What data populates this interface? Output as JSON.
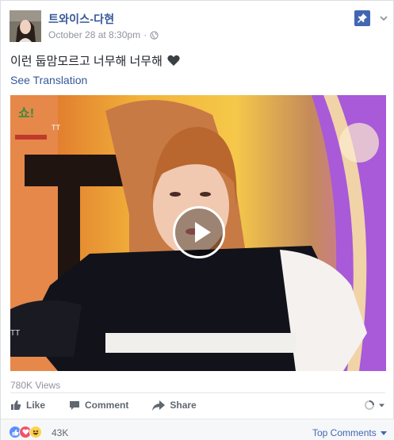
{
  "post": {
    "page_name": "트와이스-다현",
    "timestamp": "October 28 at 8:30pm",
    "separator": "·",
    "text": "이런 둡맘모르고 너무해 너무해",
    "see_translation": "See Translation"
  },
  "video": {
    "overlay_text": "TT",
    "views": "780K Views"
  },
  "actions": {
    "like": "Like",
    "comment": "Comment",
    "share": "Share"
  },
  "footer": {
    "reaction_count": "43K",
    "top_comments": "Top Comments"
  },
  "colors": {
    "link": "#365899",
    "meta": "#90949c",
    "pin_bg": "#4267b2",
    "like": "#5890ff",
    "love": "#f25268",
    "haha": "#fcd34d"
  },
  "icons": {
    "globe": "globe-icon",
    "pin": "pin-icon",
    "menu": "chevron-down-icon",
    "heart": "black-heart-icon",
    "like": "thumbs-up-icon",
    "comment": "comment-icon",
    "share": "share-icon",
    "play": "play-icon"
  }
}
